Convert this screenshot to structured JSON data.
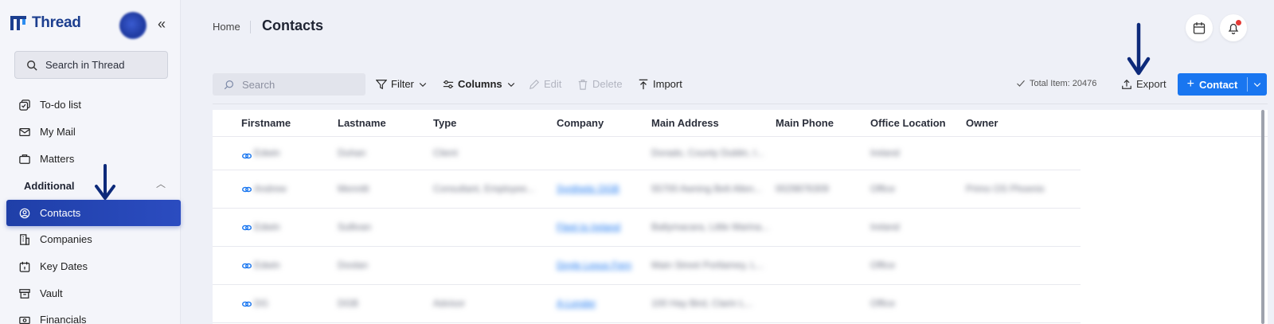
{
  "app": {
    "name": "Thread",
    "brand_color": "#1c3e8f",
    "accent": "#1976f0"
  },
  "sidebar": {
    "search_label": "Search in Thread",
    "section_additional": "Additional",
    "items": [
      {
        "label": "To-do list",
        "icon": "todo-icon"
      },
      {
        "label": "My Mail",
        "icon": "mail-icon"
      },
      {
        "label": "Matters",
        "icon": "briefcase-icon"
      },
      {
        "label": "Contacts",
        "icon": "contact-icon",
        "active": true
      },
      {
        "label": "Companies",
        "icon": "building-icon"
      },
      {
        "label": "Key Dates",
        "icon": "calendar-icon"
      },
      {
        "label": "Vault",
        "icon": "archive-icon"
      },
      {
        "label": "Financials",
        "icon": "money-icon"
      }
    ]
  },
  "header": {
    "breadcrumb_home": "Home",
    "title": "Contacts"
  },
  "toolbar": {
    "search_placeholder": "Search",
    "filter": "Filter",
    "columns": "Columns",
    "edit": "Edit",
    "delete": "Delete",
    "import": "Import",
    "total": "Total Item: 20476",
    "export": "Export",
    "add_contact": "Contact"
  },
  "table": {
    "headers": [
      "Firstname",
      "Lastname",
      "Type",
      "Company",
      "Main Address",
      "Main Phone",
      "Office Location",
      "Owner"
    ],
    "rows": [
      [
        "Edwin",
        "Duhan",
        "Client",
        "",
        "Dorado, County Dublin, I...",
        "",
        "Ireland",
        ""
      ],
      [
        "Andrew",
        "Mennitt",
        "Consultant, Employee...",
        "Synthetic DGB",
        "55700 Awning Belt Allen...",
        "0029876309",
        "Office",
        "Primo OS Phoenix"
      ],
      [
        "Edwin",
        "Sullivan",
        "",
        "Fleet to Ireland",
        "Ballymacara, Little Marina...",
        "",
        "Ireland",
        ""
      ],
      [
        "Edwin",
        "Doolan",
        "",
        "Doyle Lexus Fern",
        "Main Street Portlamey, L...",
        "",
        "Office",
        ""
      ],
      [
        "DG",
        "DGB",
        "Advisor",
        "A-Lender",
        "100 Hay Bird, Clarin L...",
        "",
        "Office",
        ""
      ]
    ]
  }
}
